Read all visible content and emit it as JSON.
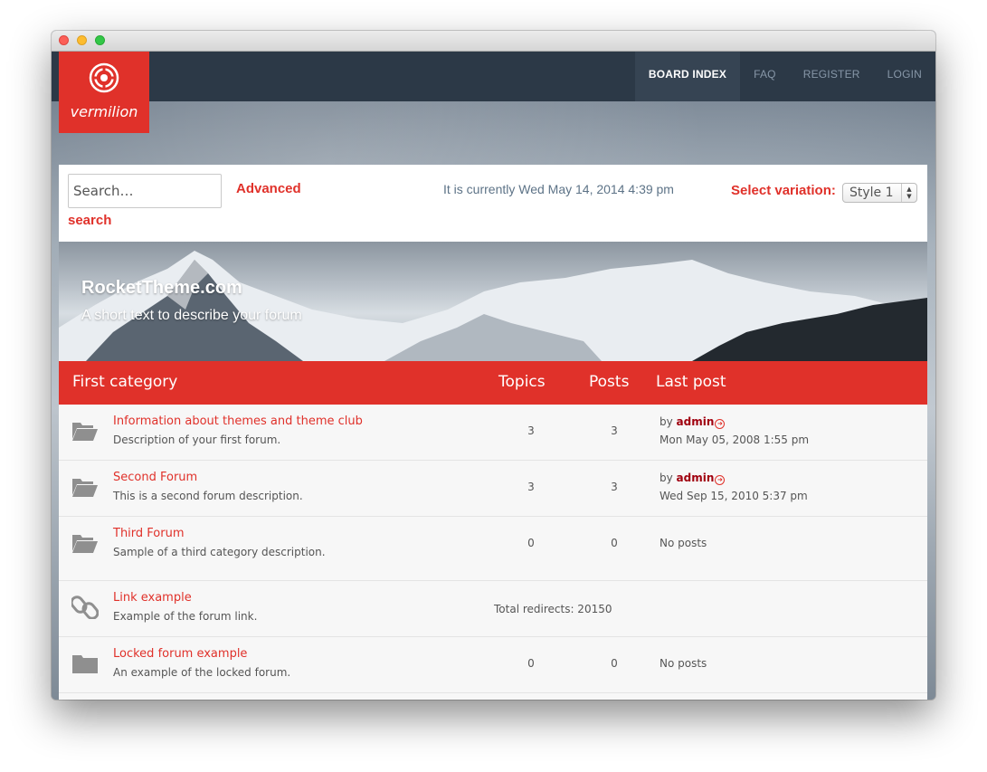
{
  "brand": {
    "name": "vermilion"
  },
  "nav": {
    "items": [
      {
        "label": "BOARD INDEX"
      },
      {
        "label": "FAQ"
      },
      {
        "label": "REGISTER"
      },
      {
        "label": "LOGIN"
      }
    ]
  },
  "search": {
    "placeholder": "Search…",
    "advanced_line1": "Advanced",
    "advanced_line2": "search"
  },
  "datetime": "It is currently Wed May 14, 2014 4:39 pm",
  "variation": {
    "label": "Select variation:",
    "selected": "Style 1"
  },
  "hero": {
    "title": "RocketTheme.com",
    "subtitle": "A short text to describe your forum"
  },
  "category": {
    "name": "First category",
    "col_topics": "Topics",
    "col_posts": "Posts",
    "col_last_post": "Last post"
  },
  "colors": {
    "accent": "#e0312a",
    "nav_bg": "#2c3947",
    "author": "#a0000f"
  },
  "forums": [
    {
      "icon": "folder-open-icon",
      "name": "Information about themes and theme club",
      "description": "Description of your first forum.",
      "topics": "3",
      "posts": "3",
      "last_by": "by",
      "last_author": "admin",
      "last_date": "Mon May 05, 2008 1:55 pm"
    },
    {
      "icon": "folder-open-icon",
      "name": "Second Forum",
      "description": "This is a second forum description.",
      "topics": "3",
      "posts": "3",
      "last_by": "by",
      "last_author": "admin",
      "last_date": "Wed Sep 15, 2010 5:37 pm"
    },
    {
      "icon": "folder-open-icon",
      "name": "Third Forum",
      "description": "Sample of a third category description.",
      "topics": "0",
      "posts": "0",
      "no_posts": "No posts"
    },
    {
      "icon": "link-icon",
      "name": "Link example",
      "description": "Example of the forum link.",
      "redirects": "Total redirects: 20150"
    },
    {
      "icon": "folder-locked-icon",
      "name": "Locked forum example",
      "description": "An example of the locked forum.",
      "topics": "0",
      "posts": "0",
      "no_posts": "No posts"
    }
  ]
}
